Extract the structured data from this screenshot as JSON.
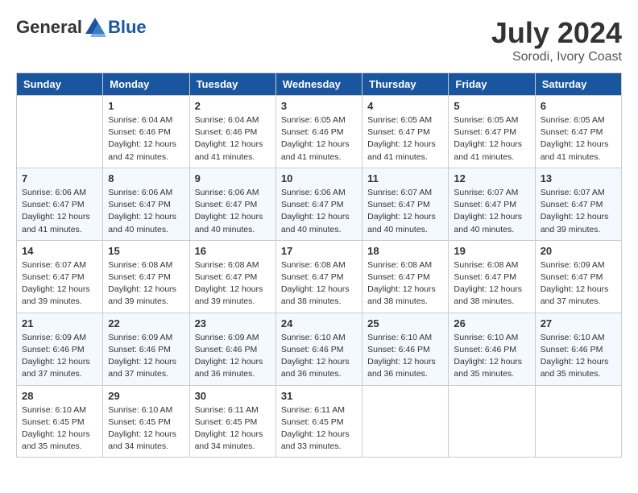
{
  "header": {
    "logo_general": "General",
    "logo_blue": "Blue",
    "month_year": "July 2024",
    "location": "Sorodi, Ivory Coast"
  },
  "days_of_week": [
    "Sunday",
    "Monday",
    "Tuesday",
    "Wednesday",
    "Thursday",
    "Friday",
    "Saturday"
  ],
  "weeks": [
    [
      {
        "day": "",
        "info": ""
      },
      {
        "day": "1",
        "info": "Sunrise: 6:04 AM\nSunset: 6:46 PM\nDaylight: 12 hours\nand 42 minutes."
      },
      {
        "day": "2",
        "info": "Sunrise: 6:04 AM\nSunset: 6:46 PM\nDaylight: 12 hours\nand 41 minutes."
      },
      {
        "day": "3",
        "info": "Sunrise: 6:05 AM\nSunset: 6:46 PM\nDaylight: 12 hours\nand 41 minutes."
      },
      {
        "day": "4",
        "info": "Sunrise: 6:05 AM\nSunset: 6:47 PM\nDaylight: 12 hours\nand 41 minutes."
      },
      {
        "day": "5",
        "info": "Sunrise: 6:05 AM\nSunset: 6:47 PM\nDaylight: 12 hours\nand 41 minutes."
      },
      {
        "day": "6",
        "info": "Sunrise: 6:05 AM\nSunset: 6:47 PM\nDaylight: 12 hours\nand 41 minutes."
      }
    ],
    [
      {
        "day": "7",
        "info": "Sunrise: 6:06 AM\nSunset: 6:47 PM\nDaylight: 12 hours\nand 41 minutes."
      },
      {
        "day": "8",
        "info": "Sunrise: 6:06 AM\nSunset: 6:47 PM\nDaylight: 12 hours\nand 40 minutes."
      },
      {
        "day": "9",
        "info": "Sunrise: 6:06 AM\nSunset: 6:47 PM\nDaylight: 12 hours\nand 40 minutes."
      },
      {
        "day": "10",
        "info": "Sunrise: 6:06 AM\nSunset: 6:47 PM\nDaylight: 12 hours\nand 40 minutes."
      },
      {
        "day": "11",
        "info": "Sunrise: 6:07 AM\nSunset: 6:47 PM\nDaylight: 12 hours\nand 40 minutes."
      },
      {
        "day": "12",
        "info": "Sunrise: 6:07 AM\nSunset: 6:47 PM\nDaylight: 12 hours\nand 40 minutes."
      },
      {
        "day": "13",
        "info": "Sunrise: 6:07 AM\nSunset: 6:47 PM\nDaylight: 12 hours\nand 39 minutes."
      }
    ],
    [
      {
        "day": "14",
        "info": "Sunrise: 6:07 AM\nSunset: 6:47 PM\nDaylight: 12 hours\nand 39 minutes."
      },
      {
        "day": "15",
        "info": "Sunrise: 6:08 AM\nSunset: 6:47 PM\nDaylight: 12 hours\nand 39 minutes."
      },
      {
        "day": "16",
        "info": "Sunrise: 6:08 AM\nSunset: 6:47 PM\nDaylight: 12 hours\nand 39 minutes."
      },
      {
        "day": "17",
        "info": "Sunrise: 6:08 AM\nSunset: 6:47 PM\nDaylight: 12 hours\nand 38 minutes."
      },
      {
        "day": "18",
        "info": "Sunrise: 6:08 AM\nSunset: 6:47 PM\nDaylight: 12 hours\nand 38 minutes."
      },
      {
        "day": "19",
        "info": "Sunrise: 6:08 AM\nSunset: 6:47 PM\nDaylight: 12 hours\nand 38 minutes."
      },
      {
        "day": "20",
        "info": "Sunrise: 6:09 AM\nSunset: 6:47 PM\nDaylight: 12 hours\nand 37 minutes."
      }
    ],
    [
      {
        "day": "21",
        "info": "Sunrise: 6:09 AM\nSunset: 6:46 PM\nDaylight: 12 hours\nand 37 minutes."
      },
      {
        "day": "22",
        "info": "Sunrise: 6:09 AM\nSunset: 6:46 PM\nDaylight: 12 hours\nand 37 minutes."
      },
      {
        "day": "23",
        "info": "Sunrise: 6:09 AM\nSunset: 6:46 PM\nDaylight: 12 hours\nand 36 minutes."
      },
      {
        "day": "24",
        "info": "Sunrise: 6:10 AM\nSunset: 6:46 PM\nDaylight: 12 hours\nand 36 minutes."
      },
      {
        "day": "25",
        "info": "Sunrise: 6:10 AM\nSunset: 6:46 PM\nDaylight: 12 hours\nand 36 minutes."
      },
      {
        "day": "26",
        "info": "Sunrise: 6:10 AM\nSunset: 6:46 PM\nDaylight: 12 hours\nand 35 minutes."
      },
      {
        "day": "27",
        "info": "Sunrise: 6:10 AM\nSunset: 6:46 PM\nDaylight: 12 hours\nand 35 minutes."
      }
    ],
    [
      {
        "day": "28",
        "info": "Sunrise: 6:10 AM\nSunset: 6:45 PM\nDaylight: 12 hours\nand 35 minutes."
      },
      {
        "day": "29",
        "info": "Sunrise: 6:10 AM\nSunset: 6:45 PM\nDaylight: 12 hours\nand 34 minutes."
      },
      {
        "day": "30",
        "info": "Sunrise: 6:11 AM\nSunset: 6:45 PM\nDaylight: 12 hours\nand 34 minutes."
      },
      {
        "day": "31",
        "info": "Sunrise: 6:11 AM\nSunset: 6:45 PM\nDaylight: 12 hours\nand 33 minutes."
      },
      {
        "day": "",
        "info": ""
      },
      {
        "day": "",
        "info": ""
      },
      {
        "day": "",
        "info": ""
      }
    ]
  ]
}
